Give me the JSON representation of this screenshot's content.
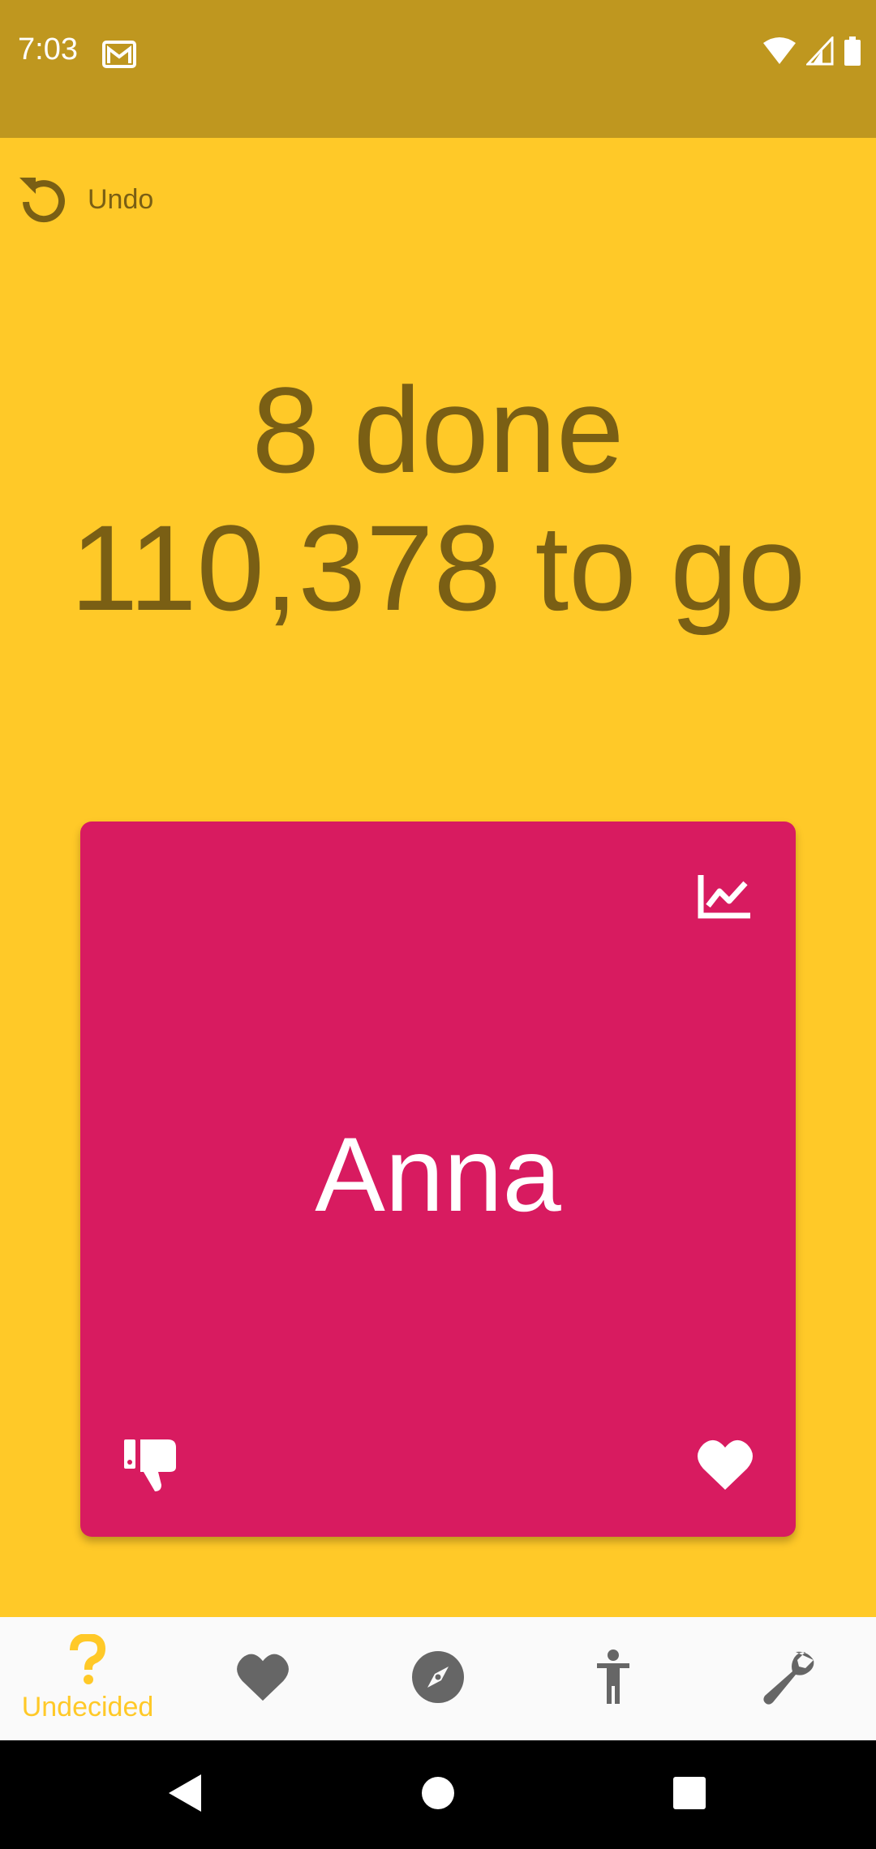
{
  "status_bar": {
    "time": "7:03",
    "icons": [
      "gmail-icon",
      "wifi-icon",
      "signal-icon",
      "battery-icon"
    ]
  },
  "undo": {
    "label": "Undo",
    "icon": "undo-icon"
  },
  "progress": {
    "done_text": "8 done",
    "to_go_text": "110,378 to go"
  },
  "card": {
    "name": "Anna",
    "color": "#D81B60",
    "icons": [
      "trending-chart-icon",
      "thumbs-down-icon",
      "heart-icon"
    ]
  },
  "bottom_nav": {
    "active": "Undecided",
    "items": [
      {
        "label": "Undecided",
        "icon": "question-icon"
      },
      {
        "label": "",
        "icon": "heart-icon"
      },
      {
        "label": "",
        "icon": "compass-icon"
      },
      {
        "label": "",
        "icon": "person-icon"
      },
      {
        "label": "",
        "icon": "wrench-icon"
      }
    ]
  },
  "colors": {
    "accent": "#FFC928",
    "status_bar": "#BF971F",
    "text_dark": "#7A5F14",
    "icon_gray": "#666666"
  }
}
